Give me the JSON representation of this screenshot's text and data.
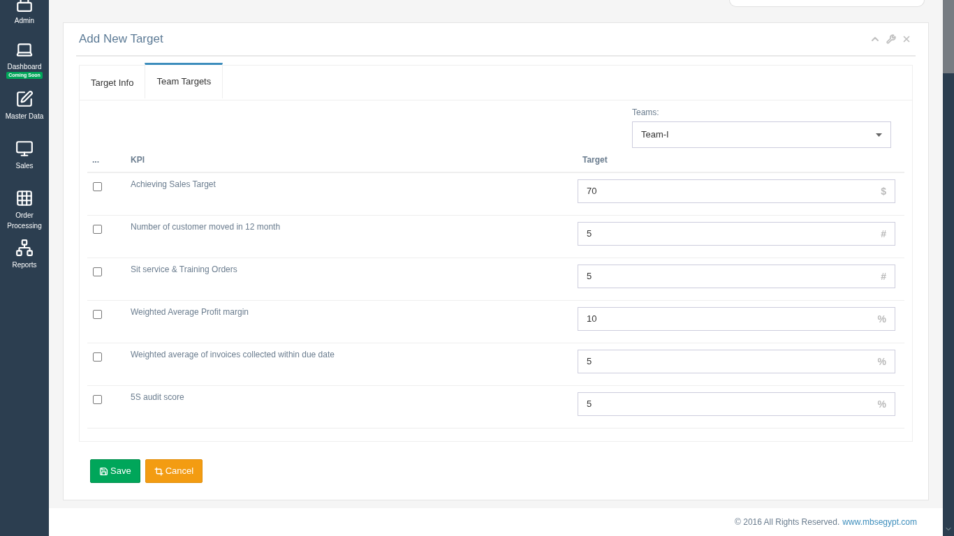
{
  "sidebar": {
    "items": [
      {
        "label": "Admin"
      },
      {
        "label": "Dashboard",
        "badge": "Coming Soon"
      },
      {
        "label": "Master Data"
      },
      {
        "label": "Sales"
      },
      {
        "label": "Order Processing"
      },
      {
        "label": "Reports"
      }
    ]
  },
  "panel": {
    "title": "Add New Target",
    "tabs": [
      {
        "label": "Target Info",
        "selected": false
      },
      {
        "label": "Team Targets",
        "selected": true
      }
    ],
    "teams": {
      "label": "Teams:",
      "value": "Team-I"
    },
    "table": {
      "columns": [
        "...",
        "KPI",
        "Target"
      ],
      "rows": [
        {
          "checked": false,
          "kpi": "Achieving Sales Target",
          "target": "70",
          "unit": "$"
        },
        {
          "checked": false,
          "kpi": "Number of customer moved in 12 month",
          "target": "5",
          "unit": "#"
        },
        {
          "checked": false,
          "kpi": "Sit service & Training Orders",
          "target": "5",
          "unit": "#"
        },
        {
          "checked": false,
          "kpi": "Weighted Average Profit margin",
          "target": "10",
          "unit": "%"
        },
        {
          "checked": false,
          "kpi": "Weighted average of invoices collected within due date",
          "target": "5",
          "unit": "%"
        },
        {
          "checked": false,
          "kpi": "5S audit score",
          "target": "5",
          "unit": "%"
        }
      ]
    },
    "buttons": [
      {
        "label": "Save",
        "kind": "save"
      },
      {
        "label": "Cancel",
        "kind": "cancel"
      }
    ]
  },
  "footer": {
    "text": "© 2016 All Rights Reserved.",
    "link": "www.mbsegypt.com"
  }
}
